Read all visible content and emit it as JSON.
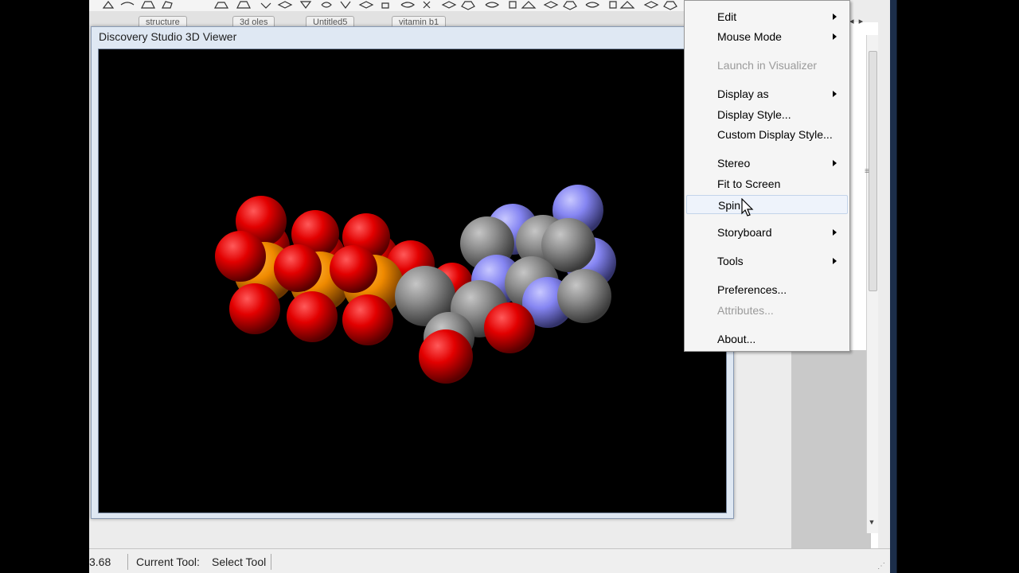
{
  "document_tabs": [
    {
      "label": "structure"
    },
    {
      "label": "3d oles"
    },
    {
      "label": "Untitled5"
    },
    {
      "label": "vitamin b1"
    }
  ],
  "viewer": {
    "title": "Discovery Studio 3D Viewer",
    "element_colors": {
      "oxygen": "#ff0d0d",
      "phosphorus": "#ff8000",
      "carbon": "#909090",
      "nitrogen": "#8080ff"
    }
  },
  "status_bar": {
    "coordinate": "3.68",
    "tool_label": "Current Tool:",
    "tool_value": "Select Tool"
  },
  "context_menu": {
    "items": [
      {
        "label": "Edit",
        "submenu": true
      },
      {
        "label": "Mouse Mode",
        "submenu": true
      },
      {
        "label": "Launch in Visualizer",
        "disabled": true
      },
      {
        "label": "Display as",
        "submenu": true
      },
      {
        "label": "Display Style..."
      },
      {
        "label": "Custom Display Style..."
      },
      {
        "label": "Stereo",
        "submenu": true
      },
      {
        "label": "Fit to Screen"
      },
      {
        "label": "Spin",
        "hover": true
      },
      {
        "label": "Storyboard",
        "submenu": true
      },
      {
        "label": "Tools",
        "submenu": true
      },
      {
        "label": "Preferences..."
      },
      {
        "label": "Attributes...",
        "disabled": true
      },
      {
        "label": "About..."
      }
    ]
  }
}
